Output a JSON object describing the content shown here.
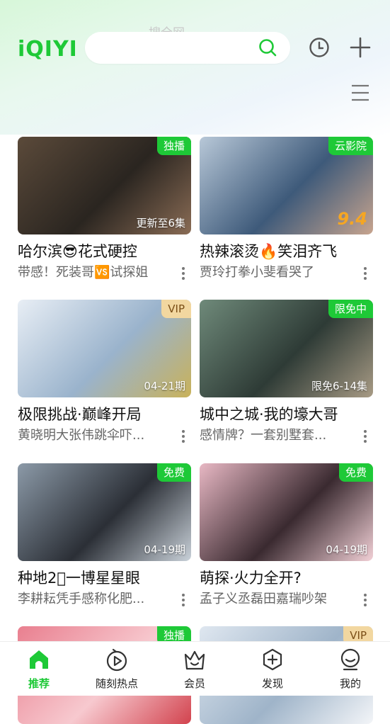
{
  "header": {
    "logo": "iQIYI",
    "search_placeholder": "搜全网"
  },
  "cards": [
    {
      "badge": "独播",
      "badge_style": "green",
      "corner": "更新至6集",
      "score": "",
      "title": "哈尔滨😎花式硬控",
      "sub": "带感！死装哥🆚试探姐",
      "thumb_colors": [
        "#5b4a3a",
        "#2a2520",
        "#8a6c55"
      ]
    },
    {
      "badge": "云影院",
      "badge_style": "green",
      "corner": "",
      "score": "9.4",
      "title": "热辣滚烫🔥笑泪齐飞",
      "sub": "贾玲打拳小斐看哭了",
      "thumb_colors": [
        "#b8c8d8",
        "#3e5a7a",
        "#c7a48e"
      ]
    },
    {
      "badge": "VIP",
      "badge_style": "gold",
      "corner": "04-21期",
      "score": "",
      "title": "极限挑战·巅峰开局",
      "sub": "黄晓明大张伟跳伞吓...",
      "thumb_colors": [
        "#e8eef5",
        "#9ab3cc",
        "#c9b25a"
      ]
    },
    {
      "badge": "限免中",
      "badge_style": "green",
      "corner": "限免6-14集",
      "score": "",
      "title": "城中之城·我的壕大哥",
      "sub": "感情牌？一套别墅套...",
      "thumb_colors": [
        "#6f8a7a",
        "#2e3b36",
        "#a89b85"
      ]
    },
    {
      "badge": "免费",
      "badge_style": "green",
      "corner": "04-19期",
      "score": "",
      "title": "种地2⃣一博星星眼",
      "sub": "李耕耘凭手感称化肥...",
      "thumb_colors": [
        "#8c9aa8",
        "#2b2f36",
        "#c9d1d9"
      ]
    },
    {
      "badge": "免费",
      "badge_style": "green",
      "corner": "04-19期",
      "score": "",
      "title": "萌探·火力全开?",
      "sub": "孟子义丞磊田嘉瑞吵架",
      "thumb_colors": [
        "#e8b8c4",
        "#3a2a30",
        "#f2d0d6"
      ]
    },
    {
      "badge": "独播",
      "badge_style": "green",
      "corner": "",
      "score": "",
      "title": "",
      "sub": "",
      "thumb_colors": [
        "#e97f8f",
        "#f7c9cf",
        "#d2434e"
      ]
    },
    {
      "badge": "VIP",
      "badge_style": "gold",
      "corner": "",
      "score": "",
      "title": "",
      "sub": "",
      "thumb_colors": [
        "#dfe7f0",
        "#9fb4c9",
        "#f3f5f8"
      ]
    }
  ],
  "tabs": [
    {
      "label": "推荐",
      "icon": "home-icon",
      "active": true
    },
    {
      "label": "随刻热点",
      "icon": "play-circle-icon",
      "active": false
    },
    {
      "label": "会员",
      "icon": "crown-icon",
      "active": false
    },
    {
      "label": "发现",
      "icon": "discover-plus-icon",
      "active": false
    },
    {
      "label": "我的",
      "icon": "profile-icon",
      "active": false
    }
  ],
  "colors": {
    "accent": "#1ec937",
    "vip_gold": "#f2d7a0"
  }
}
